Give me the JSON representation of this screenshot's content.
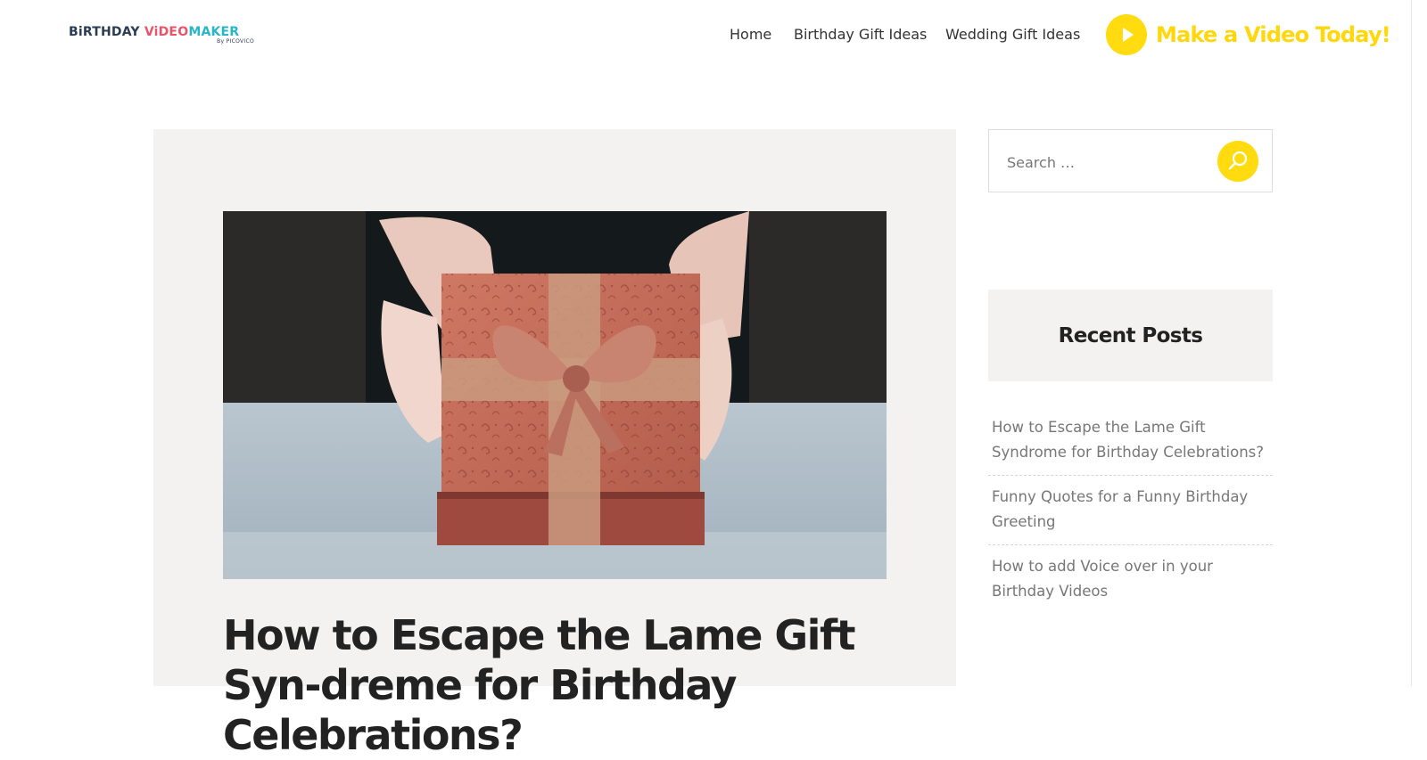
{
  "header": {
    "logo": {
      "word1": "BiRTHDAY",
      "word2": "ViDEO",
      "word3": "MAKER",
      "byline": "By PICOVICO"
    },
    "nav": [
      {
        "label": "Home"
      },
      {
        "label": "Birthday Gift Ideas"
      },
      {
        "label": "Wedding Gift Ideas"
      }
    ],
    "cta": {
      "label": "Make a Video Today!",
      "icon": "play-icon"
    }
  },
  "article": {
    "image_alt": "hands holding a red gift box with ribbon bow",
    "title": "How to Escape the Lame Gift Syn-dreme for Birthday Celebrations?"
  },
  "sidebar": {
    "search": {
      "placeholder": "Search …",
      "icon": "search-icon"
    },
    "recent_posts": {
      "heading": "Recent Posts",
      "items": [
        {
          "label": "How to Escape the Lame Gift Syndrome for Birthday Celebrations?"
        },
        {
          "label": "Funny Quotes for a Funny Birthday Greeting"
        },
        {
          "label": "How to add Voice over in your Birthday Videos"
        }
      ]
    }
  },
  "colors": {
    "accent_yellow": "#ffdb0f",
    "card_bg": "#f3f2f1",
    "logo_navy": "#2a3d55",
    "logo_pink": "#e8546a",
    "logo_teal": "#29b6c9"
  }
}
